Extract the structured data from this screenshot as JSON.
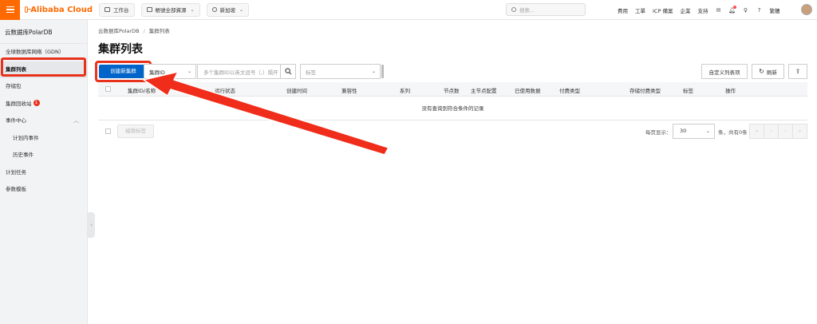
{
  "topbar": {
    "brand": "Alibaba Cloud",
    "workbench": "工作台",
    "account_scope": "帳號全部資源",
    "region": "新加坡",
    "search_placeholder": "搜索...",
    "links": [
      "費用",
      "工單",
      "ICP 備案",
      "企業",
      "支持"
    ],
    "user_label": "繁體"
  },
  "sidebar": {
    "title": "云数据库PolarDB",
    "items": [
      {
        "label": "全球数据库网络（GDN）"
      },
      {
        "label": "集群列表"
      },
      {
        "label": "存储包"
      },
      {
        "label": "集群回收站",
        "badge": "1"
      },
      {
        "label": "事件中心"
      },
      {
        "label": "计划内事件"
      },
      {
        "label": "历史事件"
      },
      {
        "label": "计划任务"
      },
      {
        "label": "参数模板"
      }
    ]
  },
  "breadcrumb": [
    "云数据库PolarDB",
    "集群列表"
  ],
  "page_title": "集群列表",
  "toolbar": {
    "create_label": "创建新集群",
    "filter_field": "集群ID",
    "search_placeholder": "多个集群ID以英文逗号（,）隔开",
    "tag_placeholder": "标签",
    "customize_label": "自定义列表项",
    "refresh_label": "刷新"
  },
  "table": {
    "columns": [
      "集群ID/名称",
      "运行状态",
      "创建时间",
      "兼容性",
      "系列",
      "节点数",
      "主节点配置",
      "已使用数据",
      "付费类型",
      "存储付费类型",
      "标签",
      "操作"
    ],
    "empty_text": "没有查询到符合条件的记录"
  },
  "footer": {
    "edit_tags_label": "编辑标签",
    "page_size_label": "每页显示：",
    "page_size": "30",
    "total_text": "条，共有0条",
    "pager": [
      "«",
      "‹",
      "›",
      "»"
    ]
  },
  "colors": {
    "brand_orange": "#ff6a00",
    "primary_blue": "#0064c8",
    "annotation_red": "#e8331c"
  }
}
